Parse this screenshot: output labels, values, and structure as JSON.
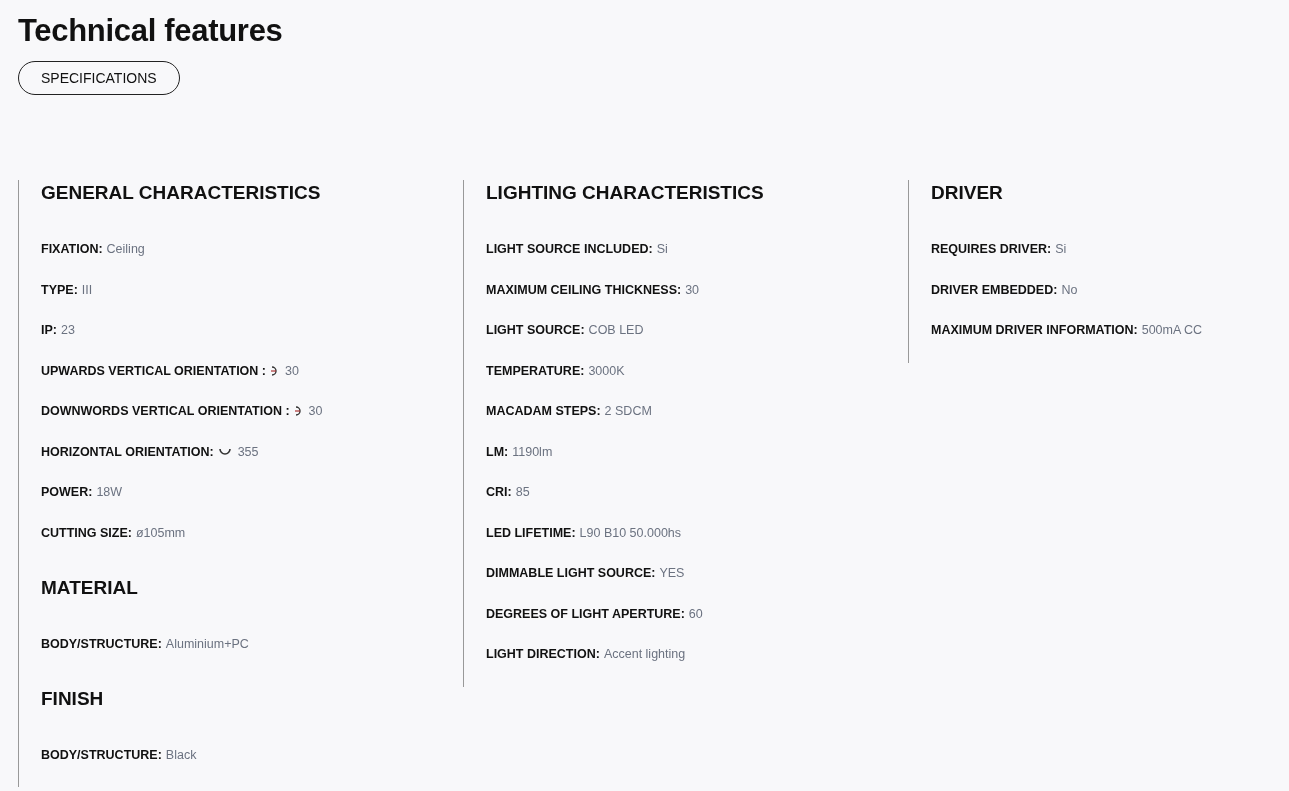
{
  "title": "Technical features",
  "tab": {
    "label": "SPECIFICATIONS",
    "selected": true
  },
  "columns": [
    {
      "sections": [
        {
          "heading": "GENERAL CHARACTERISTICS",
          "items": [
            {
              "kind": "plain",
              "label": "FIXATION:",
              "value": "Ceiling"
            },
            {
              "kind": "plain",
              "label": "TYPE:",
              "value": "III"
            },
            {
              "kind": "plain",
              "label": "IP:",
              "value": "23"
            },
            {
              "kind": "vertical",
              "label": "UPWARDS VERTICAL ORIENTATION :",
              "value": "30"
            },
            {
              "kind": "vertical",
              "label": "DOWNWORDS VERTICAL ORIENTATION :",
              "value": "30"
            },
            {
              "kind": "horizontal",
              "label": "HORIZONTAL ORIENTATION:",
              "value": "355"
            },
            {
              "kind": "plain",
              "label": "POWER:",
              "value": "18W"
            },
            {
              "kind": "plain",
              "label": "CUTTING SIZE:",
              "value": "ø105mm"
            }
          ]
        },
        {
          "heading": "MATERIAL",
          "items": [
            {
              "kind": "plain",
              "label": "BODY/STRUCTURE:",
              "value": "Aluminium+PC"
            }
          ]
        },
        {
          "heading": "FINISH",
          "items": [
            {
              "kind": "plain",
              "label": "BODY/STRUCTURE:",
              "value": "Black"
            }
          ]
        }
      ]
    },
    {
      "sections": [
        {
          "heading": "LIGHTING CHARACTERISTICS",
          "items": [
            {
              "kind": "plain",
              "label": "LIGHT SOURCE INCLUDED:",
              "value": "Si"
            },
            {
              "kind": "plain",
              "label": "MAXIMUM CEILING THICKNESS:",
              "value": "30"
            },
            {
              "kind": "plain",
              "label": "LIGHT SOURCE:",
              "value": "COB LED"
            },
            {
              "kind": "plain",
              "label": "TEMPERATURE:",
              "value": "3000K"
            },
            {
              "kind": "plain",
              "label": "MACADAM STEPS:",
              "value": "2 SDCM"
            },
            {
              "kind": "plain",
              "label": "LM:",
              "value": "1190lm"
            },
            {
              "kind": "plain",
              "label": "CRI:",
              "value": "85"
            },
            {
              "kind": "plain",
              "label": "LED LIFETIME:",
              "value": "L90 B10 50.000hs"
            },
            {
              "kind": "plain",
              "label": "DIMMABLE LIGHT SOURCE:",
              "value": "YES"
            },
            {
              "kind": "plain",
              "label": "DEGREES OF LIGHT APERTURE:",
              "value": "60"
            },
            {
              "kind": "plain",
              "label": "LIGHT DIRECTION:",
              "value": "Accent lighting"
            }
          ]
        }
      ]
    },
    {
      "sections": [
        {
          "heading": "DRIVER",
          "items": [
            {
              "kind": "plain",
              "label": "REQUIRES DRIVER:",
              "value": "Si"
            },
            {
              "kind": "plain",
              "label": "DRIVER EMBEDDED:",
              "value": "No"
            },
            {
              "kind": "plain",
              "label": "MAXIMUM DRIVER INFORMATION:",
              "value": "500mA CC"
            }
          ]
        }
      ]
    }
  ]
}
